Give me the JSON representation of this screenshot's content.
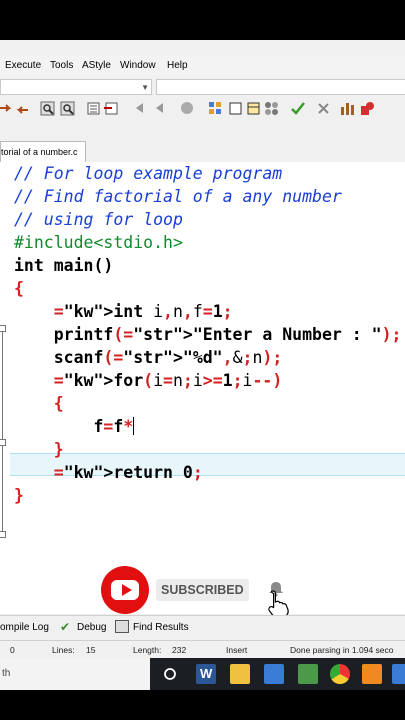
{
  "menu": [
    "Execute",
    "Tools",
    "AStyle",
    "Window",
    "Help"
  ],
  "tab": {
    "label": "torial of a number.c"
  },
  "code_lines": [
    {
      "cls": "cmt",
      "text": "// For loop example program"
    },
    {
      "cls": "cmt",
      "text": "// Find factorial of a any number"
    },
    {
      "cls": "cmt",
      "text": "// using for loop"
    },
    {
      "cls": "pre",
      "text": "#include<stdio.h>"
    },
    {
      "cls": "kw",
      "text": "int main()"
    },
    {
      "cls": "sym",
      "text": "{"
    },
    {
      "cls": "norm",
      "text": "    int i,n,f=1;"
    },
    {
      "cls": "norm",
      "text": "    printf(\"Enter a Number : \");"
    },
    {
      "cls": "norm",
      "text": "    scanf(\"%d\",&n);"
    },
    {
      "cls": "norm",
      "text": "    for(i=n;i>=1;i--)"
    },
    {
      "cls": "sym",
      "text": "    {"
    },
    {
      "cls": "norm",
      "text": "        f=f*"
    },
    {
      "cls": "sym",
      "text": "    }"
    },
    {
      "cls": "norm",
      "text": "    return 0;"
    },
    {
      "cls": "sym",
      "text": "}"
    }
  ],
  "subscribe": {
    "label": "SUBSCRIBED"
  },
  "bottom_tabs": {
    "compile_log": "ompile Log",
    "debug": "Debug",
    "find_results": "Find Results"
  },
  "status": {
    "col": "0",
    "lines_label": "Lines:",
    "lines_value": "15",
    "length_label": "Length:",
    "length_value": "232",
    "mode": "Insert",
    "message": "Done parsing in 1.094 seco"
  },
  "taskbar": {
    "search_text": "th"
  },
  "icons": [
    "folder-icon",
    "save-icon",
    "print-icon",
    "search-icon",
    "find-replace-icon",
    "indent-icon",
    "unindent-icon",
    "back-icon",
    "forward-icon",
    "grid-icon",
    "check-icon",
    "close-icon",
    "chart-icon",
    "debug-icon",
    "youtube-icon",
    "bell-icon",
    "hand-cursor-icon",
    "windows-search-icon",
    "word-icon",
    "file-explorer-icon",
    "mail-icon",
    "chrome-icon",
    "app-icon"
  ],
  "colors": {
    "comment": "#1a3fd6",
    "preprocessor": "#0f8a2c",
    "string": "#1a2fcc",
    "symbol": "#d32020",
    "highlight": "#e7f6fb",
    "youtube": "#e10f0f"
  }
}
